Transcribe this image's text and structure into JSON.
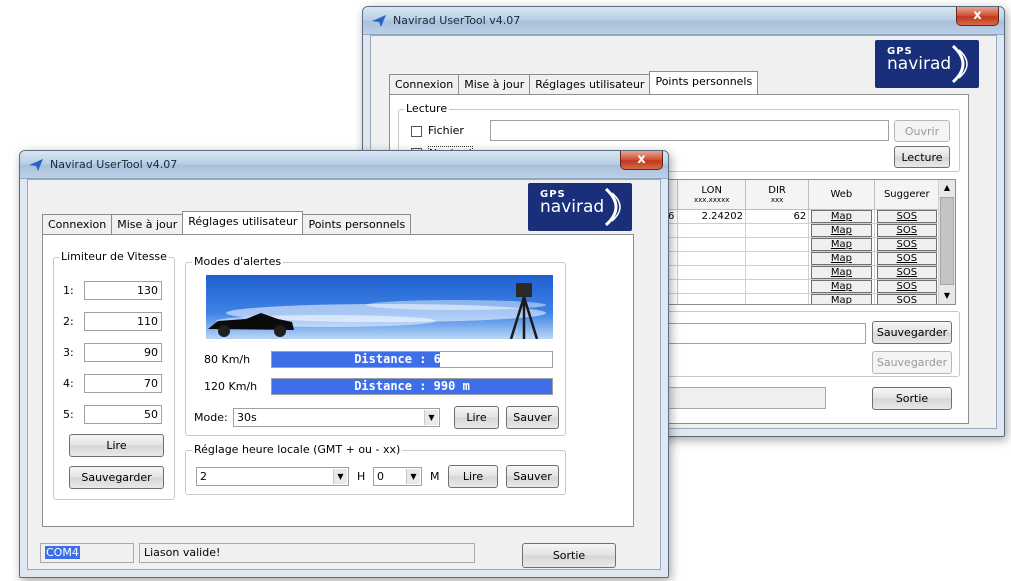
{
  "back_window": {
    "title": "Navirad UserTool v4.07",
    "close_label": "x",
    "tabs": [
      "Connexion",
      "Mise à jour",
      "Réglages utilisateur",
      "Points personnels"
    ],
    "logo": {
      "gps": "GPS",
      "brand": "navirad"
    },
    "lecture": {
      "group_label": "Lecture",
      "fichier_label": "Fichier",
      "navirad_label": "Navirad",
      "ouvrir_label": "Ouvrir",
      "lecture_button": "Lecture",
      "fichier_path": ""
    },
    "grid": {
      "headers": [
        {
          "main": "LON",
          "sub": "xxx.xxxxx"
        },
        {
          "main": "DIR",
          "sub": "xxx"
        },
        {
          "main": "Web",
          "sub": ""
        },
        {
          "main": "Suggerer",
          "sub": ""
        }
      ],
      "rows": [
        {
          "edge": "6",
          "lon": "2.24202",
          "dir": "62",
          "web": "Map",
          "sugg": "SOS"
        },
        {
          "edge": "",
          "lon": "",
          "dir": "",
          "web": "Map",
          "sugg": "SOS"
        },
        {
          "edge": "",
          "lon": "",
          "dir": "",
          "web": "Map",
          "sugg": "SOS"
        },
        {
          "edge": "",
          "lon": "",
          "dir": "",
          "web": "Map",
          "sugg": "SOS"
        },
        {
          "edge": "",
          "lon": "",
          "dir": "",
          "web": "Map",
          "sugg": "SOS"
        },
        {
          "edge": "",
          "lon": "",
          "dir": "",
          "web": "Map",
          "sugg": "SOS"
        },
        {
          "edge": "",
          "lon": "",
          "dir": "",
          "web": "Map",
          "sugg": "SOS"
        }
      ]
    },
    "sauvegarder_label": "Sauvegarder",
    "sauvegarder_disabled_label": "Sauvegarder",
    "sortie_label": "Sortie"
  },
  "front_window": {
    "title": "Navirad UserTool v4.07",
    "close_label": "x",
    "tabs": [
      "Connexion",
      "Mise à jour",
      "Réglages utilisateur",
      "Points personnels"
    ],
    "active_tab": "Réglages utilisateur",
    "logo": {
      "gps": "GPS",
      "brand": "navirad"
    },
    "limiteur": {
      "label": "Limiteur de Vitesse",
      "rows": [
        {
          "label": "1:",
          "value": "130"
        },
        {
          "label": "2:",
          "value": "110"
        },
        {
          "label": "3:",
          "value": "90"
        },
        {
          "label": "4:",
          "value": "70"
        },
        {
          "label": "5:",
          "value": "50"
        }
      ],
      "lire_label": "Lire",
      "sauvegarder_label": "Sauvegarder"
    },
    "alertes": {
      "label": "Modes d'alertes",
      "speed_rows": [
        {
          "label": "80 Km/h",
          "text": "Distance : 660 m",
          "fill": 0.6
        },
        {
          "label": "120 Km/h",
          "text": "Distance : 990 m",
          "fill": 1.0
        }
      ],
      "mode_label": "Mode:",
      "mode_value": "30s",
      "lire_label": "Lire",
      "sauver_label": "Sauver"
    },
    "heure": {
      "label": "Réglage heure locale (GMT + ou - xx)",
      "h_value": "2",
      "h_label": "H",
      "m_value": "0",
      "m_label": "M",
      "lire_label": "Lire",
      "sauver_label": "Sauver"
    },
    "status": {
      "port": "COM4",
      "message": "Liason valide!"
    },
    "sortie_label": "Sortie"
  },
  "colors": {
    "accent": "#3f6fe8",
    "logo_bg": "#1a2f7a",
    "close": "#c1381a"
  }
}
